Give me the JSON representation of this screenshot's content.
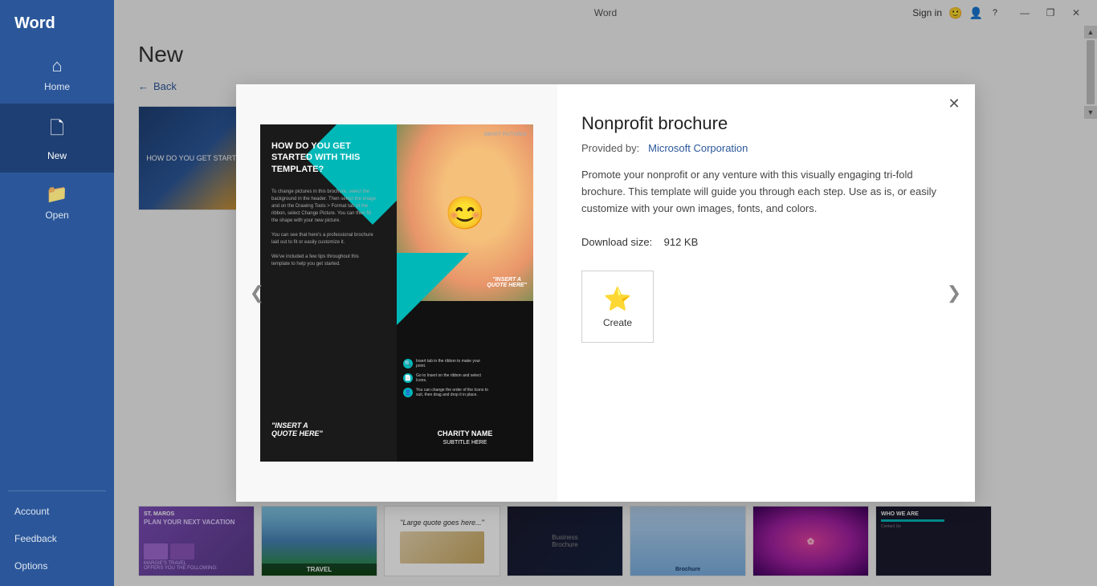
{
  "app": {
    "name": "Word",
    "title": "Word"
  },
  "titlebar": {
    "sign_in": "Sign in",
    "help_icon": "?",
    "minimize": "—",
    "restore": "❐",
    "close": "✕"
  },
  "sidebar": {
    "brand": "Word",
    "items": [
      {
        "id": "home",
        "label": "Home",
        "icon": "⌂",
        "active": false
      },
      {
        "id": "new",
        "label": "New",
        "icon": "🗋",
        "active": true
      },
      {
        "id": "open",
        "label": "Open",
        "icon": "📁",
        "active": false
      }
    ],
    "bottom_items": [
      {
        "id": "account",
        "label": "Account"
      },
      {
        "id": "feedback",
        "label": "Feedback"
      },
      {
        "id": "options",
        "label": "Options"
      }
    ]
  },
  "page": {
    "title": "New",
    "back_label": "Back"
  },
  "modal": {
    "template_name": "Nonprofit brochure",
    "provided_by_label": "Provided by:",
    "provider": "Microsoft Corporation",
    "description": "Promote your nonprofit or any venture with this visually engaging tri-fold brochure. This template will guide you through each step. Use as is, or easily customize with your own images, fonts, and colors.",
    "download_size_label": "Download size:",
    "download_size": "912 KB",
    "create_label": "Create",
    "close_icon": "✕",
    "prev_icon": "❮",
    "next_icon": "❯"
  },
  "bottom_templates": [
    {
      "id": 1,
      "label": "Travel template"
    },
    {
      "id": 2,
      "label": "Large quote"
    },
    {
      "id": 3,
      "label": "Business brochure"
    },
    {
      "id": 4,
      "label": "Brochure"
    },
    {
      "id": 5,
      "label": "Floral template"
    },
    {
      "id": 6,
      "label": "Who we are"
    }
  ]
}
